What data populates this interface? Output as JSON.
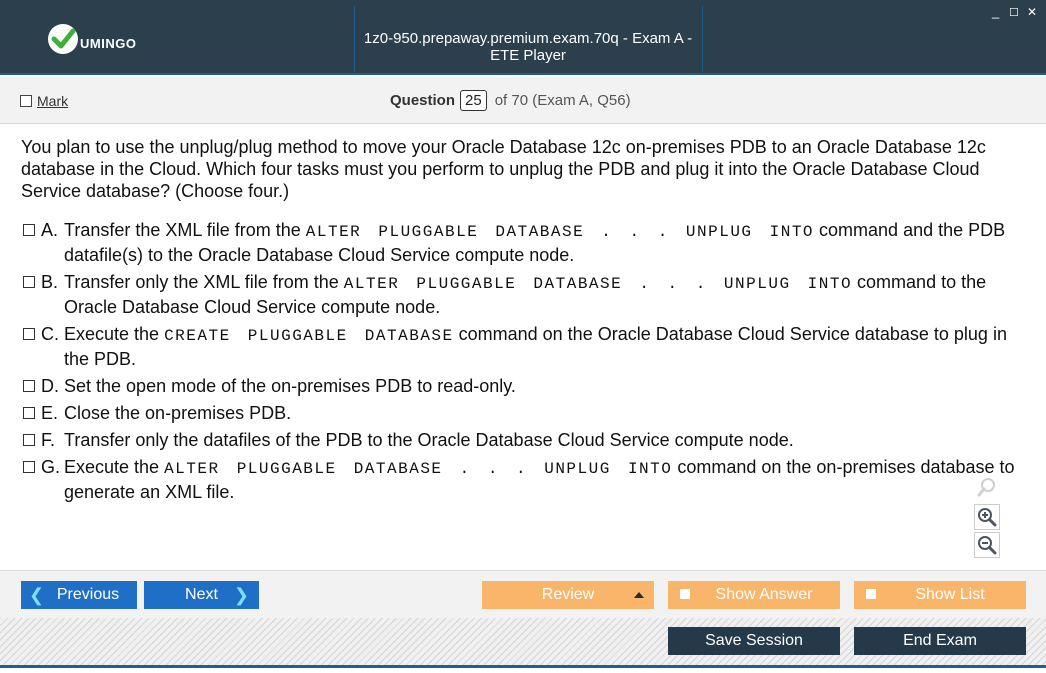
{
  "window": {
    "title": "1z0-950.prepaway.premium.exam.70q - Exam A - ETE Player",
    "logo_text": "UMINGO",
    "controls": [
      "_",
      "☐",
      "✕"
    ]
  },
  "header": {
    "mark_label": "Mark",
    "question_label": "Question",
    "question_number": "25",
    "question_of": "of 70 (Exam A, Q56)"
  },
  "question": {
    "text": "You plan to use the unplug/plug method to move your Oracle Database 12c on-premises PDB to an Oracle Database 12c database in the Cloud. Which four tasks must you perform to unplug the PDB and plug it into the Oracle Database Cloud Service database? (Choose four.)"
  },
  "options": [
    {
      "letter": "A.",
      "t1": "Transfer the XML file from the ",
      "code": "ALTER PLUGGABLE DATABASE . . . UNPLUG INTO",
      "t2": " command and the PDB datafile(s) to the Oracle Database Cloud Service compute node."
    },
    {
      "letter": "B.",
      "t1": "Transfer only the XML file from the ",
      "code": "ALTER PLUGGABLE DATABASE . . . UNPLUG INTO",
      "t2": " command to the Oracle Database Cloud Service compute node."
    },
    {
      "letter": "C.",
      "t1": "Execute the ",
      "code": "CREATE PLUGGABLE DATABASE",
      "t2": " command on the Oracle Database Cloud Service database to plug in the PDB."
    },
    {
      "letter": "D.",
      "t1": "Set the open mode of the on-premises PDB to read-only.",
      "code": "",
      "t2": ""
    },
    {
      "letter": "E.",
      "t1": "Close the on-premises PDB.",
      "code": "",
      "t2": ""
    },
    {
      "letter": "F.",
      "t1": "Transfer only the datafiles of the PDB to the Oracle Database Cloud Service compute node.",
      "code": "",
      "t2": ""
    },
    {
      "letter": "G.",
      "t1": "Execute the ",
      "code": "ALTER PLUGGABLE DATABASE . . . UNPLUG INTO",
      "t2": " command on the on-premises database to generate an XML file."
    }
  ],
  "nav": {
    "previous": "Previous",
    "next": "Next",
    "review": "Review",
    "show_answer": "Show Answer",
    "show_list": "Show List",
    "save_session": "Save Session",
    "end_exam": "End Exam"
  },
  "colors": {
    "titlebar": "#2b3f4c",
    "accent_blue": "#1f6fc7",
    "orange": "#f9b66a",
    "dark_button": "#24394a",
    "border_blue": "#1d5f8e"
  },
  "icons": {
    "logo": "check-logo-icon",
    "zoom_search": "magnifier-icon",
    "zoom_in": "zoom-in-icon",
    "zoom_out": "zoom-out-icon",
    "previous": "chevron-left-icon",
    "next": "chevron-right-icon",
    "review": "triangle-up-icon"
  }
}
